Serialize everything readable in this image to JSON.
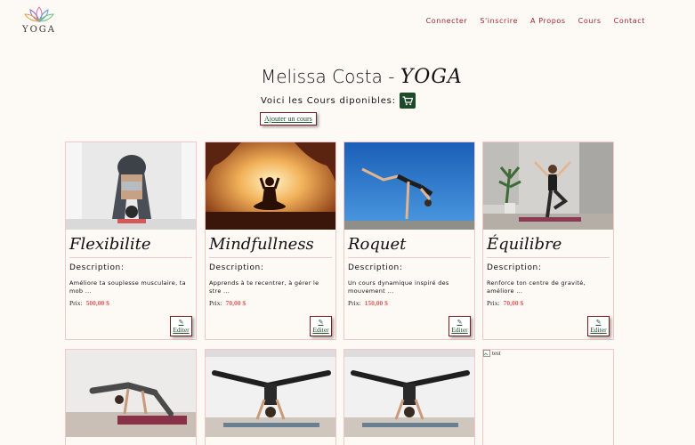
{
  "header": {
    "logo_text": "YOGA",
    "nav": [
      "Connecter",
      "S'inscrire",
      "A Propos",
      "Cours",
      "Contact"
    ]
  },
  "hero": {
    "title_main": "Melissa Costa - ",
    "title_accent": "YOGA",
    "subtitle": "Voici les Cours diponibles:",
    "cart_icon": "shopping-cart-icon",
    "add_course": "Ajouter un cours"
  },
  "colors": {
    "accent": "#a0262e",
    "button_green": "#1d4a2a",
    "price": "#e05a5a",
    "card_border": "#f3c7c7"
  },
  "courses": [
    {
      "title": "Flexibilite",
      "desc_label": "Description:",
      "desc": "Améliore ta souplesse musculaire, ta mob ...",
      "price_label": "Prix:",
      "price": "500,00 $",
      "edit": "Editer"
    },
    {
      "title": "Mindfullness",
      "desc_label": "Description:",
      "desc": "Apprends à te recentrer, à gérer le stre ...",
      "price_label": "Prix:",
      "price": "70,00 $",
      "edit": "Editer"
    },
    {
      "title": "Roquet",
      "desc_label": "Description:",
      "desc": "Un cours dynamique inspiré des mouvement ...",
      "price_label": "Prix:",
      "price": "150,00 $",
      "edit": "Editer"
    },
    {
      "title": "Équilibre",
      "desc_label": "Description:",
      "desc": "Renforce ton centre de gravité, améliore ...",
      "price_label": "Prix:",
      "price": "70,00 $",
      "edit": "Editer"
    }
  ],
  "broken_image_alt": "test"
}
